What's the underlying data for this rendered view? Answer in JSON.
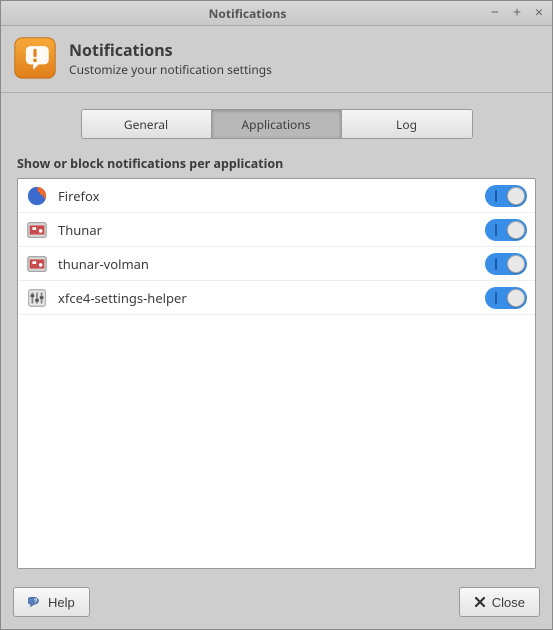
{
  "window": {
    "title": "Notifications"
  },
  "header": {
    "title": "Notifications",
    "subtitle": "Customize your notification settings"
  },
  "tabs": {
    "general": "General",
    "applications": "Applications",
    "log": "Log",
    "active": "applications"
  },
  "section": {
    "label": "Show or block notifications per application"
  },
  "apps": [
    {
      "name": "Firefox",
      "enabled": true,
      "icon": "firefox"
    },
    {
      "name": "Thunar",
      "enabled": true,
      "icon": "thunar"
    },
    {
      "name": "thunar-volman",
      "enabled": true,
      "icon": "thunar-volman"
    },
    {
      "name": "xfce4-settings-helper",
      "enabled": true,
      "icon": "settings-helper"
    }
  ],
  "footer": {
    "help": "Help",
    "close": "Close"
  }
}
